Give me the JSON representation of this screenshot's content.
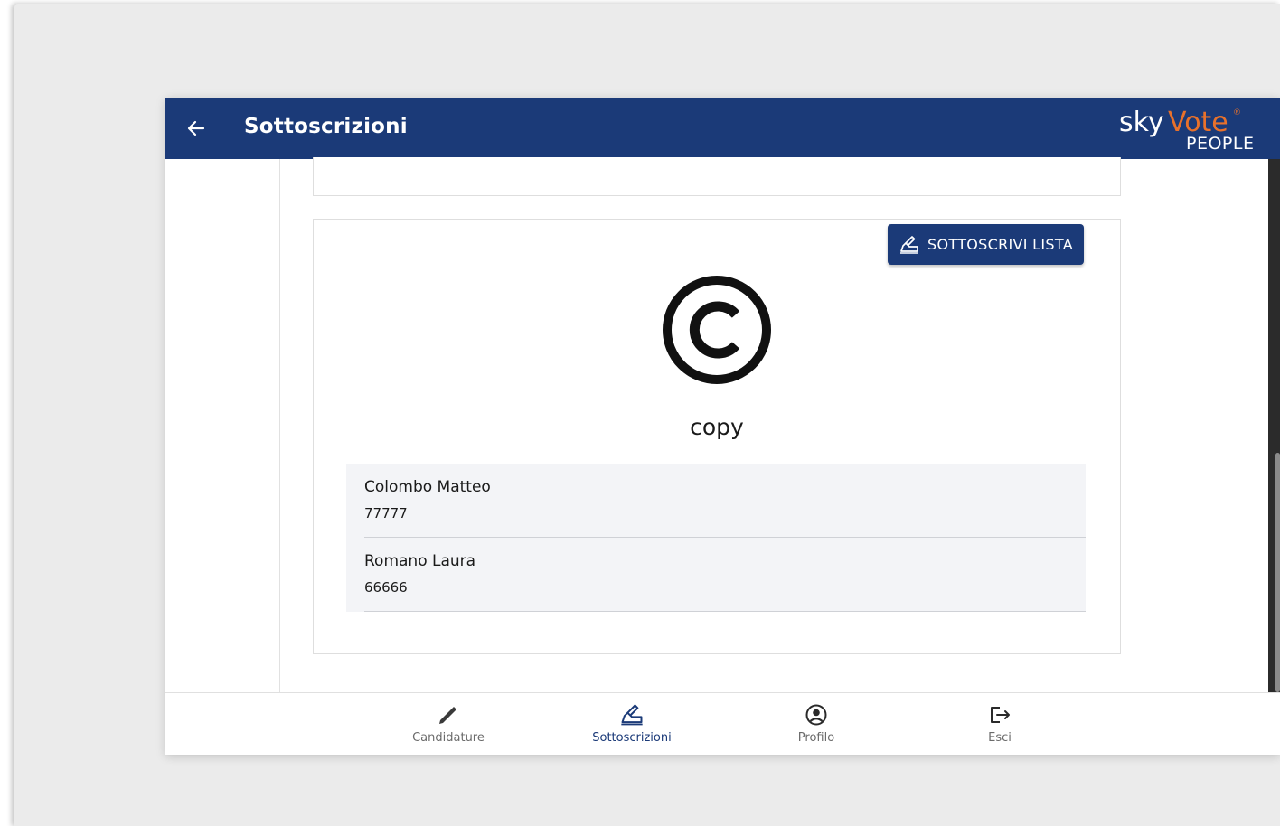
{
  "header": {
    "title": "Sottoscrizioni",
    "logo": {
      "sky": "sky",
      "vote": "Vote",
      "registered": "®",
      "people": "PEOPLE"
    }
  },
  "card": {
    "sign_button_label": "SOTTOSCRIVI LISTA",
    "list_name": "copy",
    "signers": [
      {
        "name": "Colombo Matteo",
        "number": "77777"
      },
      {
        "name": "Romano Laura",
        "number": "66666"
      }
    ]
  },
  "bottom_nav": {
    "items": [
      {
        "label": "Candidature",
        "icon": "pencil-icon"
      },
      {
        "label": "Sottoscrizioni",
        "icon": "signing-hand-icon",
        "active": true
      },
      {
        "label": "Profilo",
        "icon": "account-circle-icon"
      },
      {
        "label": "Esci",
        "icon": "logout-icon"
      }
    ]
  },
  "colors": {
    "primary": "#1b3a78",
    "accent_orange": "#e8712b",
    "list_background": "#f3f4f7"
  }
}
